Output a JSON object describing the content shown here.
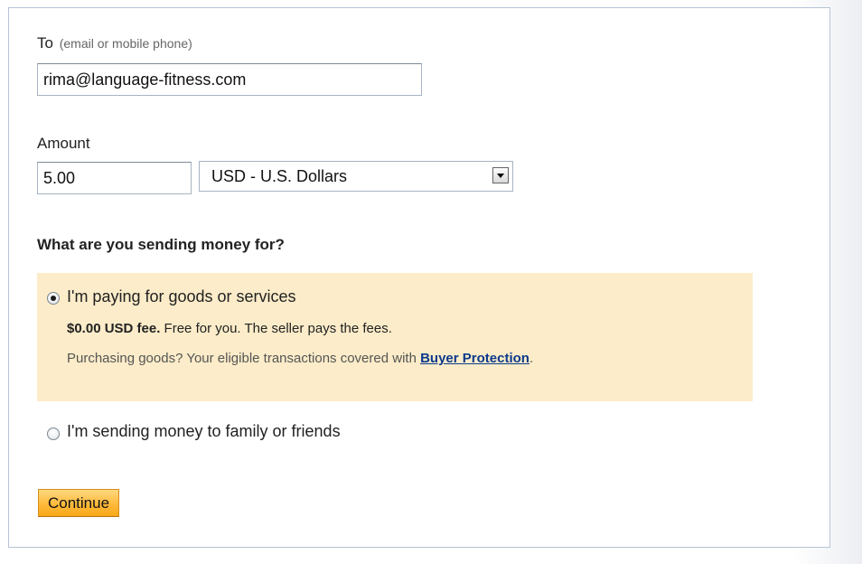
{
  "recipient": {
    "label": "To",
    "hint": "(email or mobile phone)",
    "value": "rima@language-fitness.com"
  },
  "amount": {
    "label": "Amount",
    "value": "5.00",
    "currency": "USD - U.S. Dollars"
  },
  "purpose": {
    "question": "What are you sending money for?",
    "goods": {
      "label": "I'm paying for goods or services",
      "selected": true,
      "fee_bold": "$0.00 USD fee.",
      "fee_text": " Free for you. The seller pays the fees.",
      "protection_text": "Purchasing goods? Your eligible transactions covered with ",
      "protection_link": "Buyer Protection",
      "protection_end": ".",
      "highlight_color": "#fcecc9"
    },
    "family": {
      "label": "I'm sending money to family or friends",
      "selected": false
    }
  },
  "continue_button": "Continue",
  "colors": {
    "button": "#ffba3b",
    "link": "#0b3a8c",
    "panel_border": "#b6c4d6"
  },
  "icons": {
    "select_arrow": "chevron-down-icon"
  }
}
